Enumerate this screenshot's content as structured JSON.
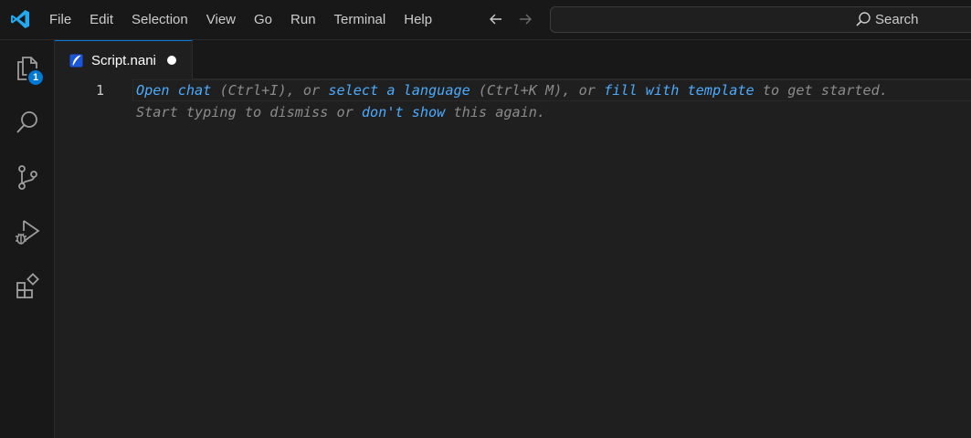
{
  "menu": {
    "items": [
      "File",
      "Edit",
      "Selection",
      "View",
      "Go",
      "Run",
      "Terminal",
      "Help"
    ]
  },
  "search": {
    "label": "Search"
  },
  "activity": {
    "explorer_badge": "1"
  },
  "tab": {
    "label": "Script.nani",
    "dirty": true
  },
  "editor": {
    "line_number": "1",
    "hint_line1": {
      "link1": "Open chat",
      "text1": " (Ctrl+I), or ",
      "link2": "select a language",
      "text2": " (Ctrl+K M), or ",
      "link3": "fill with template",
      "text3": " to get started."
    },
    "hint_line2": {
      "text1": "Start typing to dismiss or ",
      "link1": "don't show",
      "text2": " this again."
    }
  },
  "colors": {
    "accent": "#0078d4",
    "link": "#4daafc",
    "background": "#1f1f1f",
    "chrome": "#181818"
  }
}
